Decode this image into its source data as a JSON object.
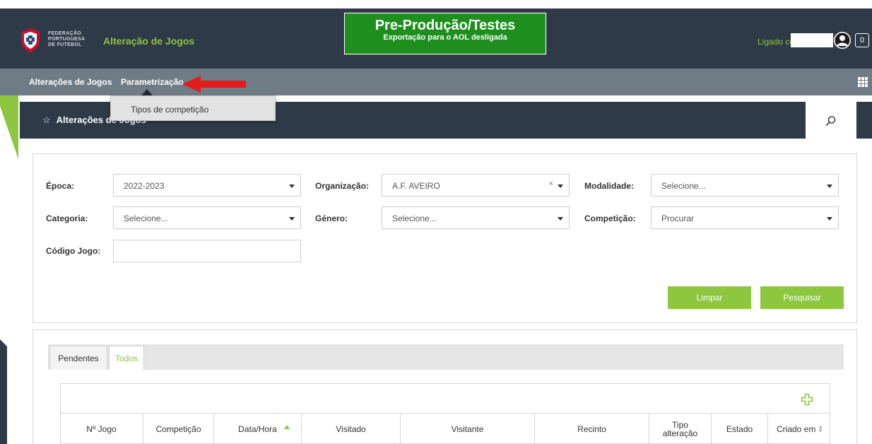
{
  "header": {
    "org_line1": "FEDERAÇÃO",
    "org_line2": "PORTUGUESA",
    "org_line3": "DE FUTEBOL",
    "app_title": "Alteração de Jogos",
    "env_title": "Pre-Produção/Testes",
    "env_subtitle": "Exportação para o AOL desligada",
    "login_label": "Ligado como:",
    "notification_count": "0"
  },
  "nav": {
    "items": [
      {
        "label": "Alterações de Jogos"
      },
      {
        "label": "Parametrização"
      }
    ],
    "dropdown": {
      "items": [
        {
          "label": "Tipos de competição"
        }
      ]
    },
    "apps_icon": "grid-icon"
  },
  "page": {
    "title": "Alterações de Jogos",
    "title_icon": "star-icon",
    "search_icon": "search-icon"
  },
  "filters": {
    "epoca": {
      "label": "Época:",
      "value": "2022-2023"
    },
    "organizacao": {
      "label": "Organização:",
      "value": "A.F. AVEIRO",
      "clear": "×"
    },
    "modalidade": {
      "label": "Modalidade:",
      "value": "Selecione..."
    },
    "categoria": {
      "label": "Categoria:",
      "value": "Selecione..."
    },
    "genero": {
      "label": "Género:",
      "value": "Selecione..."
    },
    "competicao": {
      "label": "Competição:",
      "value": "Procurar"
    },
    "codigo_jogo": {
      "label": "Código Jogo:",
      "value": ""
    }
  },
  "buttons": {
    "clear_label": "Limpar",
    "search_label": "Pesquisar"
  },
  "tabs": [
    {
      "label": "Pendentes",
      "active": false
    },
    {
      "label": "Todos",
      "active": true
    }
  ],
  "table": {
    "add_icon": "plus-icon",
    "columns": [
      {
        "label": "Nº Jogo"
      },
      {
        "label": "Competição"
      },
      {
        "label": "Data/Hora"
      },
      {
        "label": "Visitado"
      },
      {
        "label": "Visitante"
      },
      {
        "label": "Recinto"
      },
      {
        "label": "Tipo alteração"
      },
      {
        "label": "Estado"
      },
      {
        "label": "Criado em"
      }
    ]
  },
  "colors": {
    "dark_header": "#2e3a47",
    "nav_gray": "#707c85",
    "accent_green": "#8dc63f",
    "env_green": "#1e8f1e",
    "annotation_red": "#e31b1b"
  }
}
